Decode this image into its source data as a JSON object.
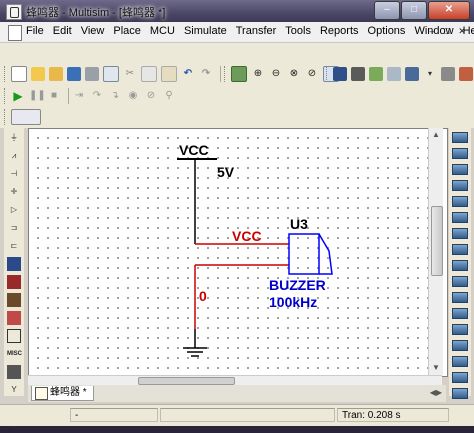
{
  "window": {
    "title": "蜂鸣器 - Multisim - [蜂鸣器 *]",
    "minimize": "–",
    "maximize": "□",
    "close": "✕"
  },
  "menu": {
    "items": [
      "File",
      "Edit",
      "View",
      "Place",
      "MCU",
      "Simulate",
      "Transfer",
      "Tools",
      "Reports",
      "Options",
      "Window",
      "Help"
    ]
  },
  "mdi_controls": [
    "–",
    "□",
    "✕"
  ],
  "schematic": {
    "vcc_source_label": "VCC",
    "vcc_voltage": "5V",
    "net_vcc_label": "VCC",
    "net_0_label": "0",
    "buzzer_ref": "U3",
    "buzzer_type": "BUZZER",
    "buzzer_freq": "100kHz",
    "colors": {
      "wire": "#cc0000",
      "part": "#0000ff",
      "text": "#000000",
      "net_label": "#cc0000"
    }
  },
  "doc_tab": {
    "label": "蜂鸣器 *"
  },
  "status": {
    "left": "-",
    "middle": "",
    "tran": "Tran: 0.208 s"
  }
}
